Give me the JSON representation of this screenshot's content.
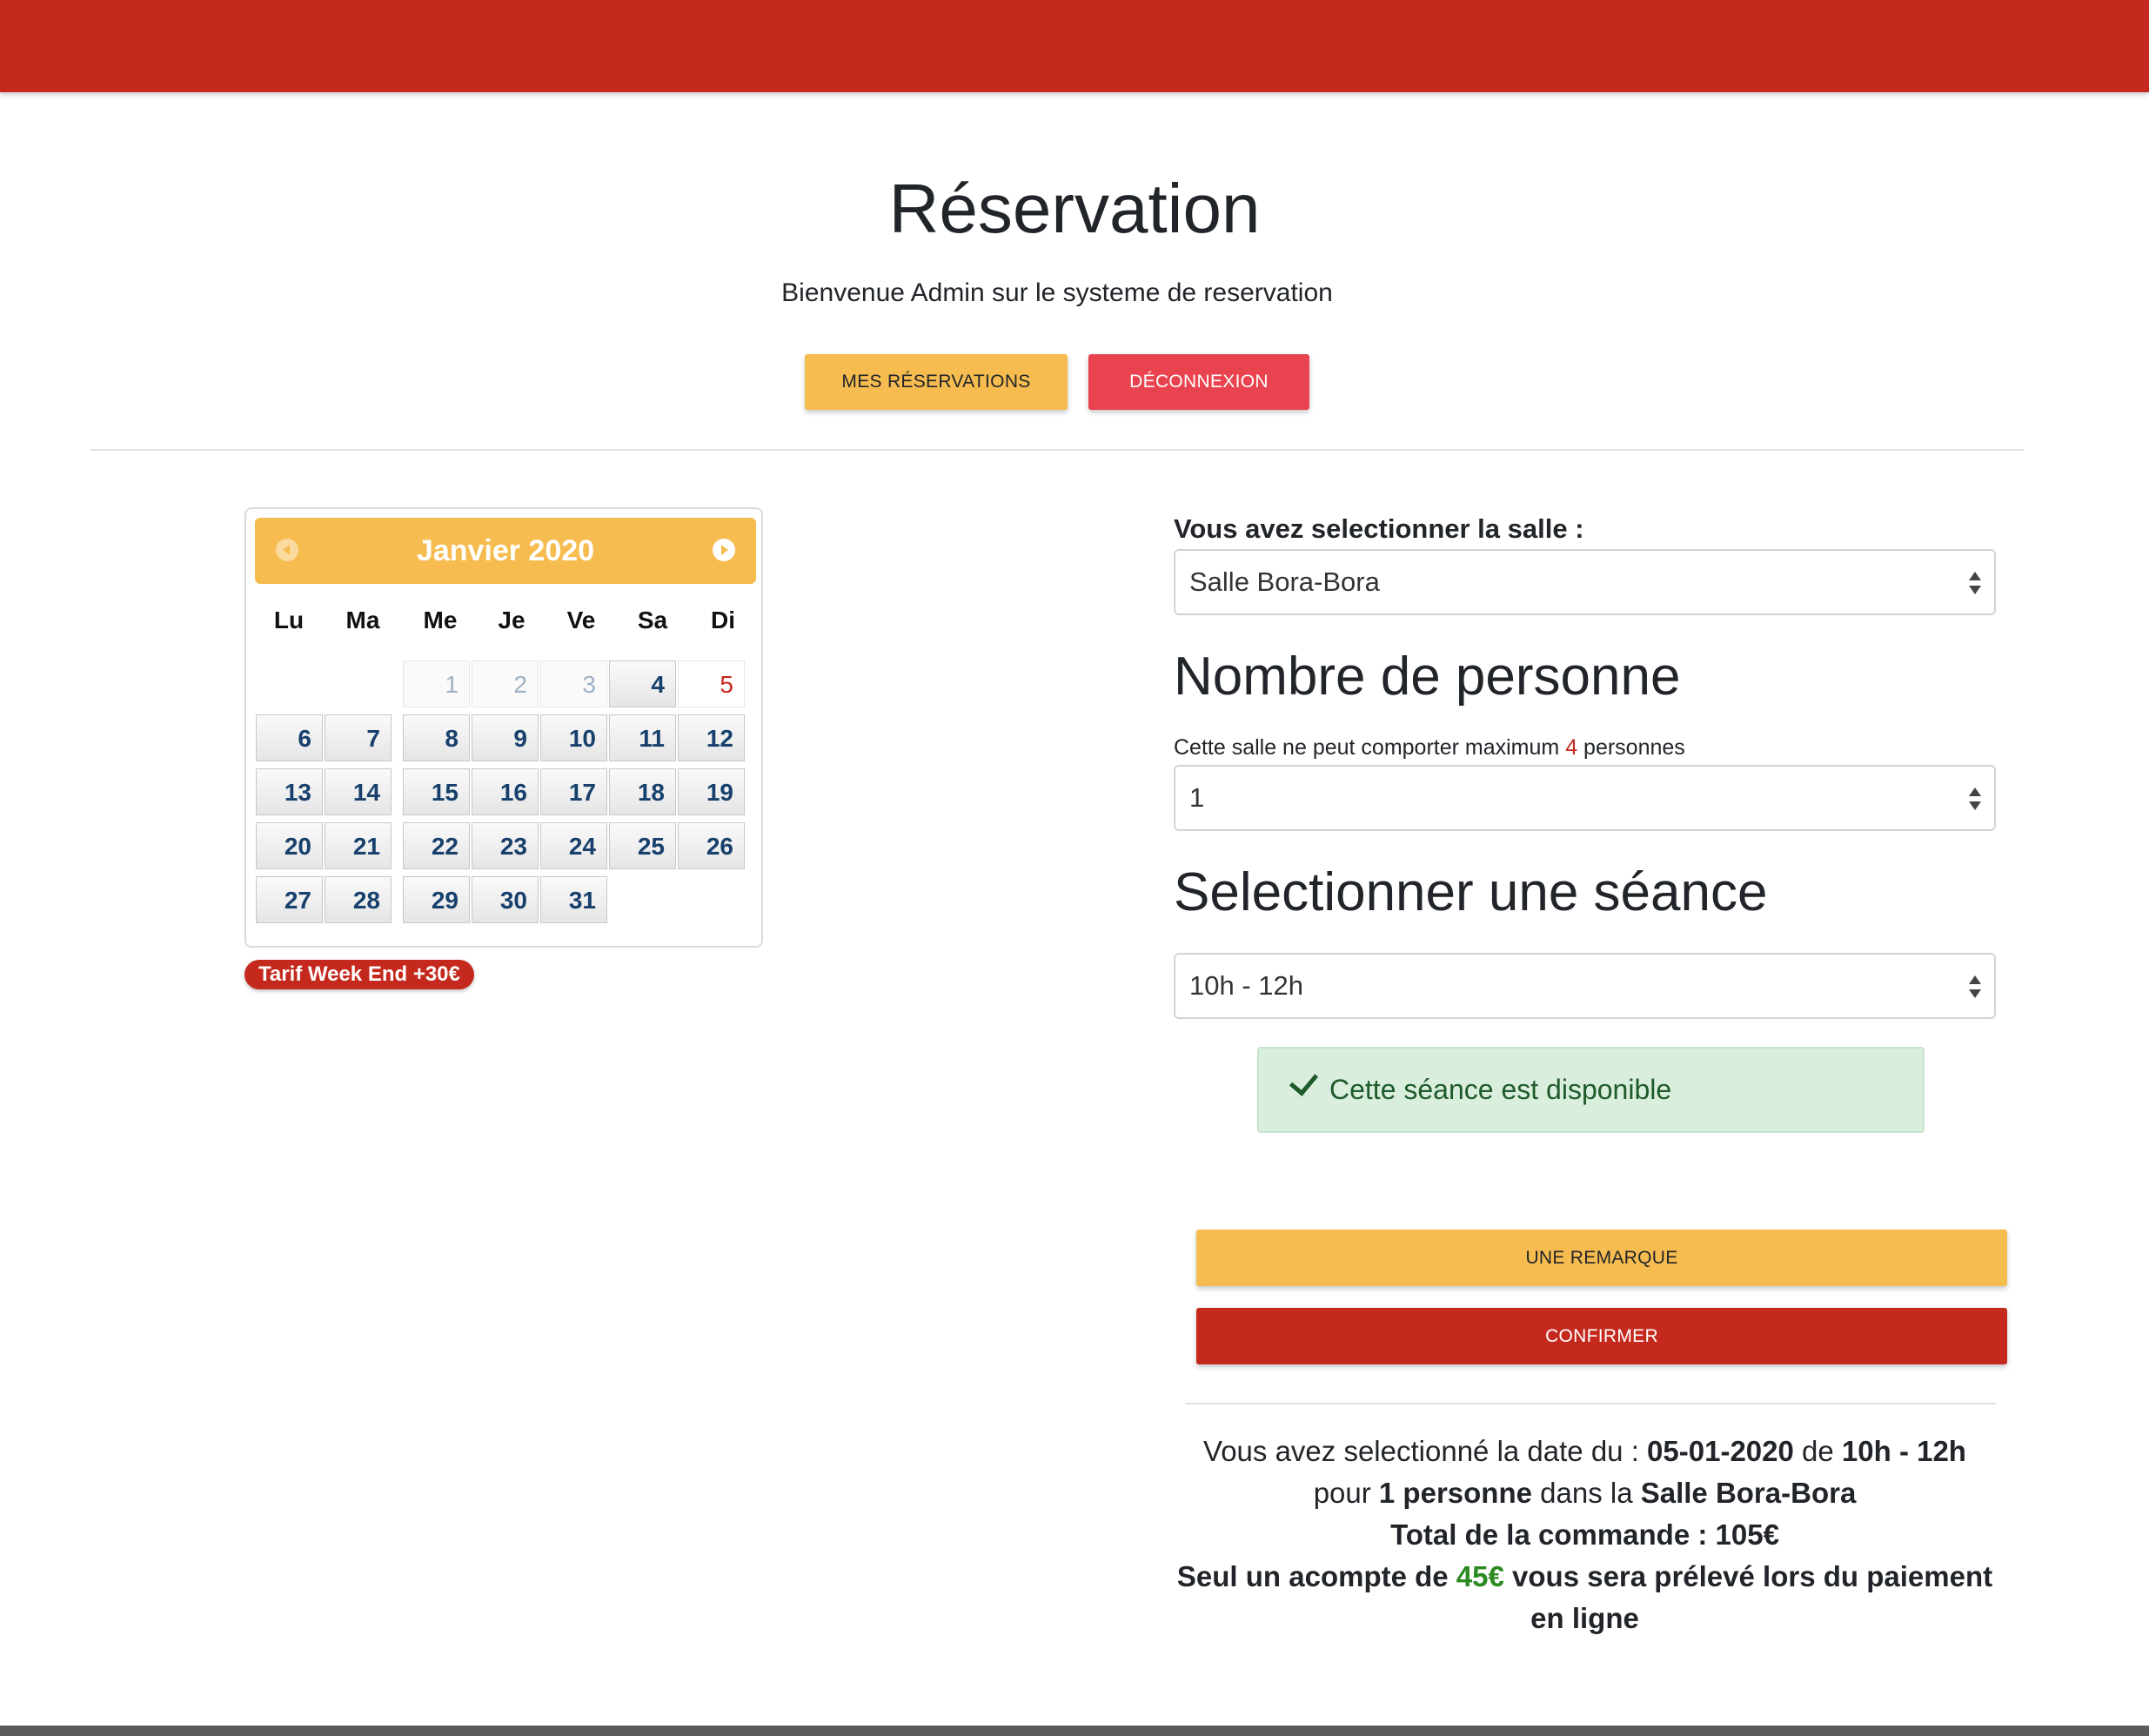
{
  "header": {
    "title": "Réservation",
    "welcome": "Bienvenue Admin sur le systeme de reservation",
    "my_reservations_label": "MES RÉSERVATIONS",
    "logout_label": "DÉCONNEXION"
  },
  "calendar": {
    "title": "Janvier 2020",
    "weekdays": [
      "Lu",
      "Ma",
      "Me",
      "Je",
      "Ve",
      "Sa",
      "Di"
    ],
    "days": {
      "d1": "1",
      "d2": "2",
      "d3": "3",
      "d4": "4",
      "d5": "5",
      "d6": "6",
      "d7": "7",
      "d8": "8",
      "d9": "9",
      "d10": "10",
      "d11": "11",
      "d12": "12",
      "d13": "13",
      "d14": "14",
      "d15": "15",
      "d16": "16",
      "d17": "17",
      "d18": "18",
      "d19": "19",
      "d20": "20",
      "d21": "21",
      "d22": "22",
      "d23": "23",
      "d24": "24",
      "d25": "25",
      "d26": "26",
      "d27": "27",
      "d28": "28",
      "d29": "29",
      "d30": "30",
      "d31": "31"
    },
    "selected_day": "5",
    "weekend_badge": "Tarif Week End +30€"
  },
  "form": {
    "room_label": "Vous avez selectionner la salle :",
    "room_value": "Salle Bora-Bora",
    "people_heading": "Nombre de personne",
    "capacity_prefix": "Cette salle ne peut comporter maximum ",
    "capacity_max": "4",
    "capacity_suffix": " personnes",
    "people_value": "1",
    "session_heading": "Selectionner une séance",
    "session_value": "10h - 12h",
    "availability": "Cette séance est disponible",
    "remark_label": "UNE REMARQUE",
    "confirm_label": "CONFIRMER"
  },
  "summary": {
    "p1": "Vous avez selectionné la date du : ",
    "date": "05-01-2020",
    "p2": " de ",
    "session": "10h - 12h",
    "p3": " pour ",
    "people": "1 personne",
    "p4": " dans la ",
    "room": "Salle Bora-Bora",
    "total": "Total de la commande : 105€",
    "deposit_prefix": "Seul un acompte de ",
    "deposit_amount": "45€",
    "deposit_suffix": " vous sera prélevé lors du paiement en ligne"
  },
  "colors": {
    "brand_red": "#c5291d",
    "accent_yellow": "#f6bc4f",
    "danger_red": "#e8434e",
    "success_green": "#2c8a21"
  }
}
